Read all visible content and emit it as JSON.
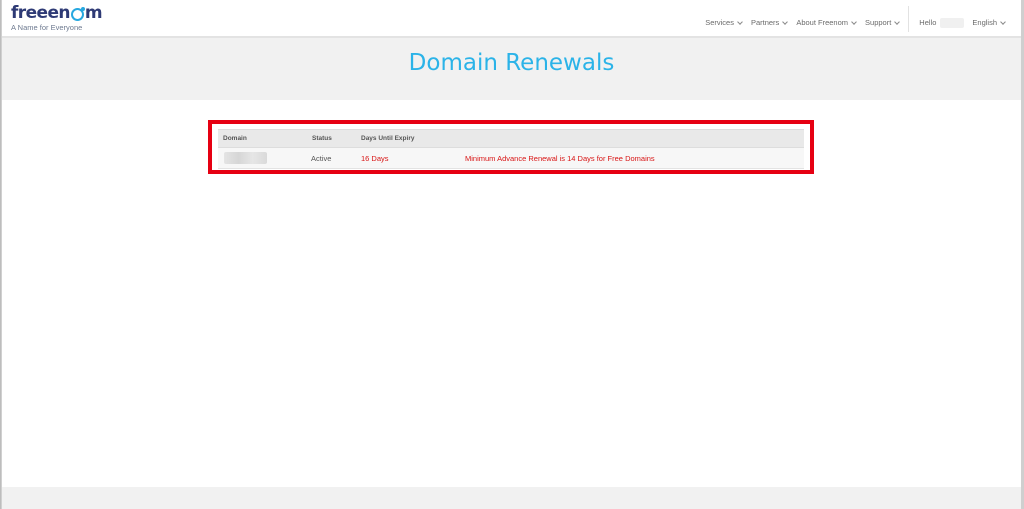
{
  "brand": {
    "logo_dark": "free",
    "logo_end": "m",
    "tagline": "A Name for Everyone"
  },
  "nav": {
    "items": [
      {
        "label": "Services"
      },
      {
        "label": "Partners"
      },
      {
        "label": "About Freenom"
      },
      {
        "label": "Support"
      }
    ],
    "hello": "Hello",
    "language": "English"
  },
  "page": {
    "title": "Domain Renewals"
  },
  "table": {
    "headers": {
      "domain": "Domain",
      "status": "Status",
      "days": "Days Until Expiry"
    },
    "rows": [
      {
        "status": "Active",
        "days": "16 Days",
        "note": "Minimum Advance Renewal is 14 Days for Free Domains"
      }
    ]
  },
  "colors": {
    "accent": "#2bb3e8",
    "brand_dark": "#2e3a75",
    "highlight": "#e60012",
    "warning_text": "#d81414"
  }
}
